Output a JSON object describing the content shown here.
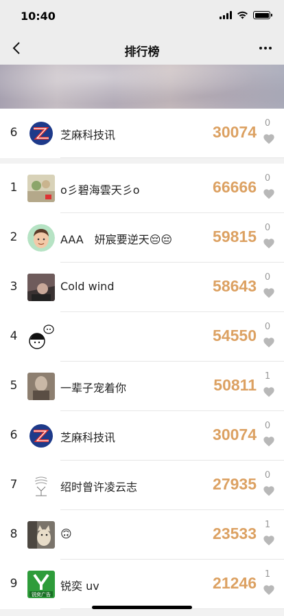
{
  "status_bar": {
    "time": "10:40"
  },
  "nav": {
    "title": "排行榜",
    "back_icon": "chevron-left-icon",
    "more_icon": "more-horizontal-icon"
  },
  "my_rank": {
    "rank": "6",
    "name": "芝麻科技讯",
    "steps": "30074",
    "likes": "0"
  },
  "ranking": [
    {
      "rank": "1",
      "name": "o彡碧海雲天彡o",
      "steps": "66666",
      "likes": "0"
    },
    {
      "rank": "2",
      "name": "AAA　妍宸要逆天😔😔",
      "steps": "59815",
      "likes": "0"
    },
    {
      "rank": "3",
      "name": "Cold wind",
      "steps": "58643",
      "likes": "0"
    },
    {
      "rank": "4",
      "name": "",
      "steps": "54550",
      "likes": "0"
    },
    {
      "rank": "5",
      "name": "一辈子宠着你",
      "steps": "50811",
      "likes": "1"
    },
    {
      "rank": "6",
      "name": "芝麻科技讯",
      "steps": "30074",
      "likes": "0"
    },
    {
      "rank": "7",
      "name": "绍时曾许凌云志",
      "steps": "27935",
      "likes": "0"
    },
    {
      "rank": "8",
      "name": "🙃",
      "steps": "23533",
      "likes": "1"
    },
    {
      "rank": "9",
      "name": "锐奕 uv",
      "steps": "21246",
      "likes": "1"
    }
  ],
  "colors": {
    "steps": "#dca162",
    "heart": "#b8b8b8",
    "nav_bg": "#ededed"
  },
  "icons": {
    "heart": "heart-icon",
    "avatar_9_text": "锐奕广告"
  }
}
